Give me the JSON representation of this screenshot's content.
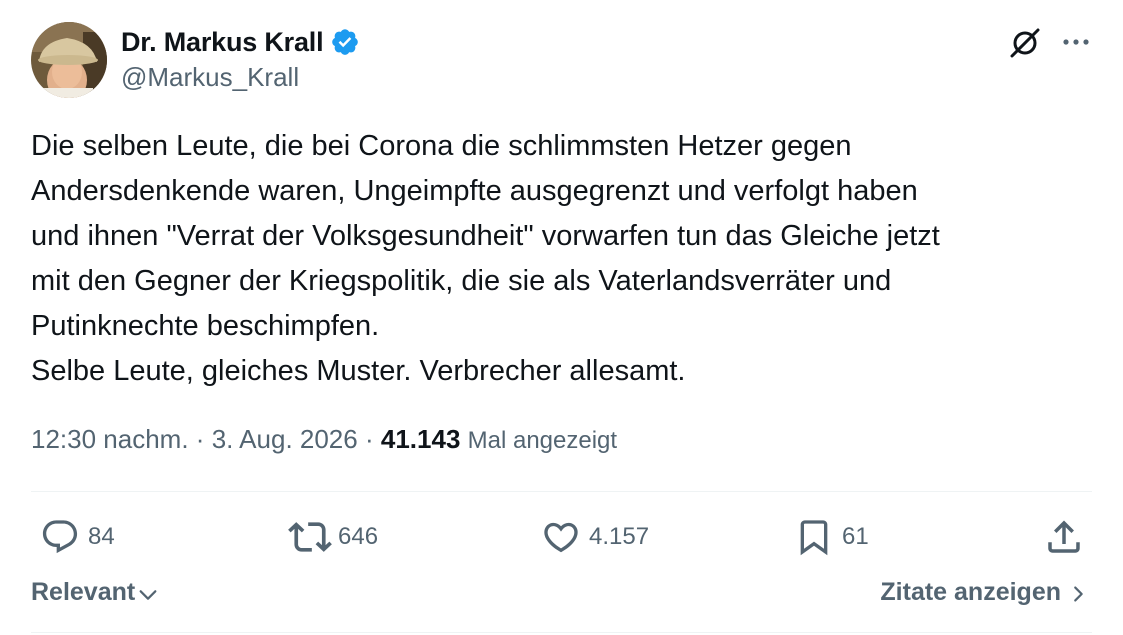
{
  "author": {
    "display_name": "Dr. Markus Krall",
    "handle": "@Markus_Krall",
    "verified": true
  },
  "tweet": {
    "text": "Die selben Leute, die bei Corona die schlimmsten Hetzer gegen\nAndersdenkende waren, Ungeimpfte ausgegrenzt und verfolgt haben\nund ihnen \"Verrat der Volksgesundheit\" vorwarfen tun das Gleiche jetzt\nmit den Gegner der Kriegspolitik, die sie als Vaterlandsverräter und\nPutinknechte beschimpfen.\nSelbe Leute, gleiches Muster. Verbrecher allesamt.",
    "time": "12:30 nachm.",
    "separator": "·",
    "date": "3. Aug. 2026",
    "views_count": "41.143",
    "views_label": "Mal angezeigt"
  },
  "actions": {
    "replies": "84",
    "reposts": "646",
    "likes": "4.157",
    "bookmarks": "61"
  },
  "footer": {
    "sort_label": "Relevant",
    "quotes_label": "Zitate anzeigen"
  },
  "colors": {
    "text_primary": "#0f1419",
    "text_secondary": "#536471",
    "verified_blue": "#1d9bf0",
    "divider": "#eff3f4"
  },
  "icons": {
    "verified": "verified-badge-icon",
    "grok": "grok-icon",
    "more": "more-options-icon",
    "reply": "reply-icon",
    "repost": "repost-icon",
    "like": "like-icon",
    "bookmark": "bookmark-icon",
    "share": "share-icon",
    "sort": "chevron-down-icon",
    "quotes": "chevron-right-icon"
  }
}
